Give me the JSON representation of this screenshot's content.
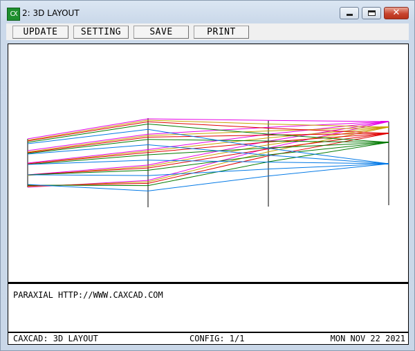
{
  "window": {
    "icon_text": "CX",
    "title": "2: 3D LAYOUT",
    "minimize_glyph": "minimize-icon",
    "maximize_glyph": "maximize-icon",
    "close_glyph": "✕"
  },
  "toolbar": {
    "update_label": "UPDATE",
    "setting_label": "SETTING",
    "save_label": "SAVE",
    "print_label": "PRINT"
  },
  "info": {
    "text": "PARAXIAL HTTP://WWW.CAXCAD.COM"
  },
  "status": {
    "left": "CAXCAD: 3D LAYOUT",
    "config": "CONFIG: 1/1",
    "date": "MON NOV 22 2021"
  },
  "colors": {
    "ray_colors": [
      "#e600e6",
      "#c8a000",
      "#e00000",
      "#007a00",
      "#0078e6"
    ]
  }
}
